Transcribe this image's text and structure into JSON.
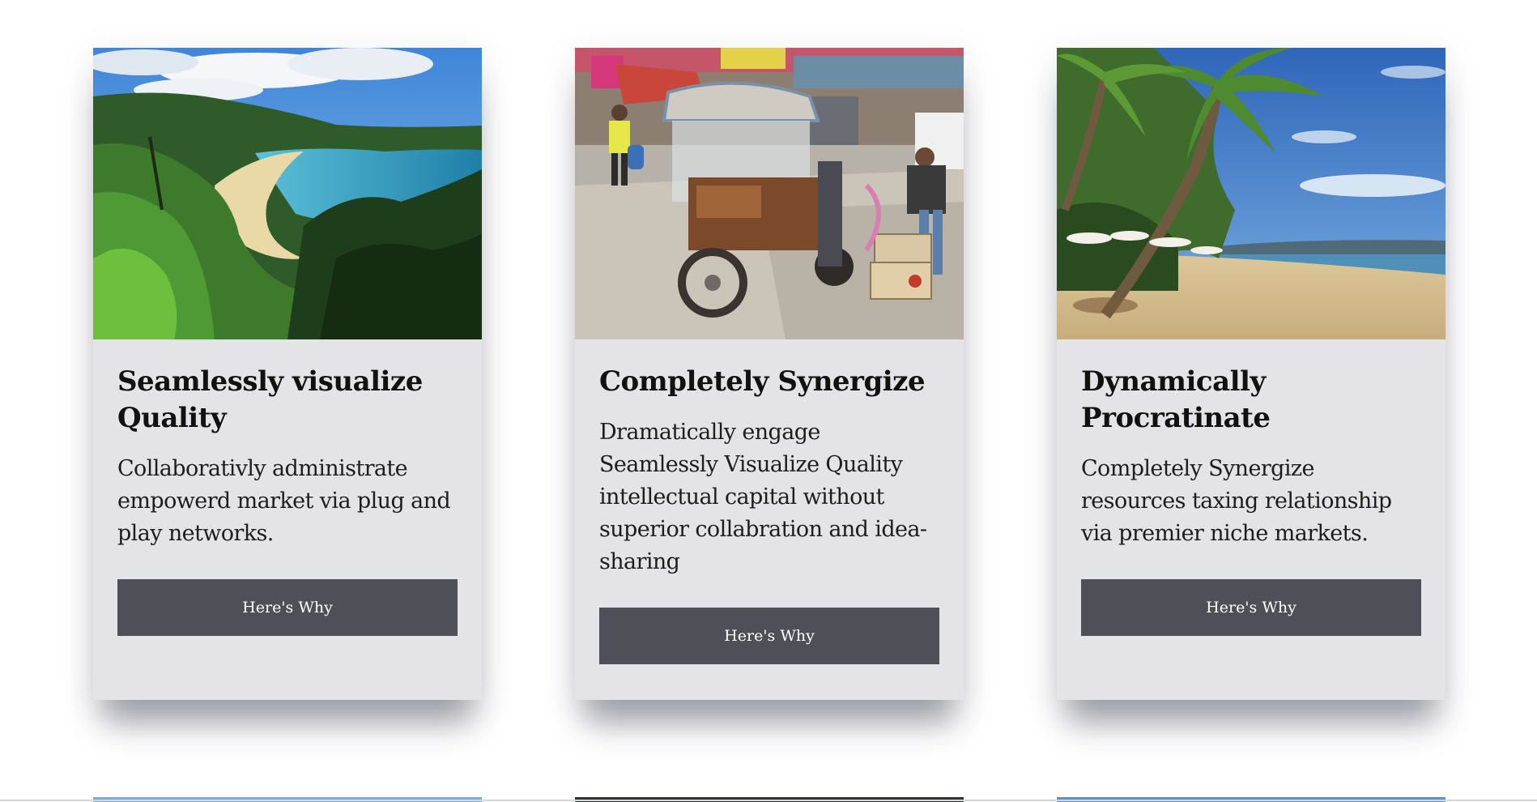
{
  "cards": [
    {
      "image": "tropical-bay-coastline-photo",
      "title": "Seamlessly visualize Quality",
      "text": "Collaborativly administrate empowerd market via plug and play networks.",
      "button": "Here's Why"
    },
    {
      "image": "street-tuk-tuk-market-photo",
      "title": "Completely Synergize",
      "text": "Dramatically engage Seamlessly Visualize Quality intellectual capital without superior collabration and idea-sharing",
      "button": "Here's Why"
    },
    {
      "image": "palm-tree-beach-photo",
      "title": "Dynamically Procratinate",
      "text": "Completely Synergize resources taxing relationship via premier niche markets.",
      "button": "Here's Why"
    }
  ],
  "colors": {
    "card_background": "#e4e3e7",
    "button_background": "#4f4f57",
    "button_text": "#ffffff",
    "heading_text": "#111111"
  }
}
